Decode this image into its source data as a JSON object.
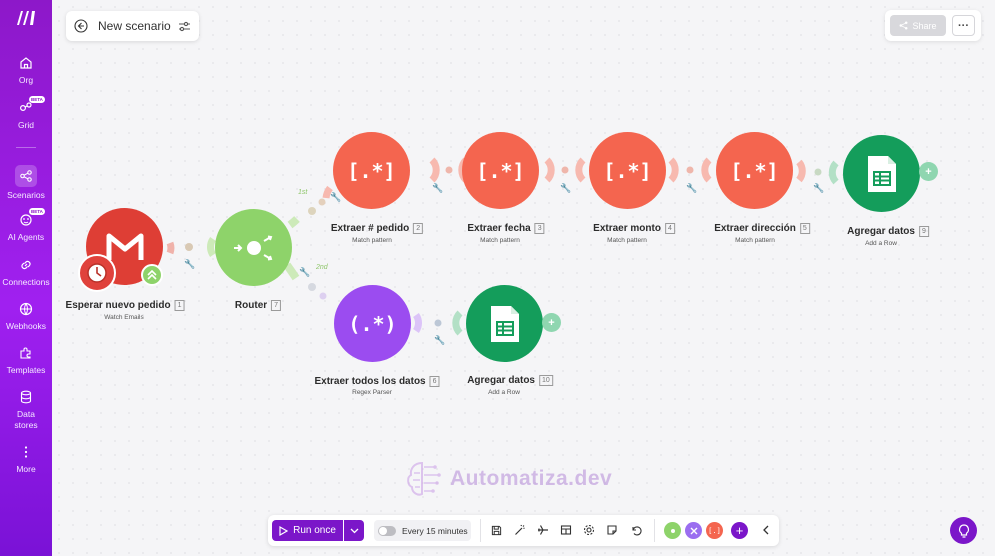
{
  "sidebar": {
    "items": [
      {
        "label": "Org",
        "icon": "home-icon"
      },
      {
        "label": "Grid",
        "icon": "grid-icon",
        "badge": "BETA"
      },
      {
        "label": "Scenarios",
        "icon": "share-nodes-icon",
        "active": true
      },
      {
        "label": "AI Agents",
        "icon": "ai-agent-icon",
        "badge": "BETA"
      },
      {
        "label": "Connections",
        "icon": "link-icon"
      },
      {
        "label": "Webhooks",
        "icon": "globe-icon"
      },
      {
        "label": "Templates",
        "icon": "puzzle-icon"
      },
      {
        "label": "Data stores",
        "icon": "database-icon"
      },
      {
        "label": "More",
        "icon": "more-vertical-icon"
      }
    ]
  },
  "header": {
    "title": "New scenario",
    "share_label": "Share",
    "more_label": "···"
  },
  "modules": {
    "gmail": {
      "name": "Esperar nuevo pedido",
      "num": "1",
      "sub": "Watch Emails",
      "color": "#de3e35"
    },
    "router": {
      "name": "Router",
      "num": "7",
      "color": "#8ed36a"
    },
    "extract_order": {
      "name": "Extraer # pedido",
      "num": "2",
      "sub": "Match pattern",
      "color": "#f4654f"
    },
    "extract_date": {
      "name": "Extraer fecha",
      "num": "3",
      "sub": "Match pattern",
      "color": "#f4654f"
    },
    "extract_amount": {
      "name": "Extraer monto",
      "num": "4",
      "sub": "Match pattern",
      "color": "#f4654f"
    },
    "extract_address": {
      "name": "Extraer dirección",
      "num": "5",
      "sub": "Match pattern",
      "color": "#f4654f"
    },
    "sheets_top": {
      "name": "Agregar datos",
      "num": "9",
      "sub": "Add a Row",
      "color": "#149d5b"
    },
    "regex_all": {
      "name": "Extraer todos los datos",
      "num": "6",
      "sub": "Regex Parser",
      "color": "#9b4cf0"
    },
    "sheets_bottom": {
      "name": "Agregar datos",
      "num": "10",
      "sub": "Add a Row",
      "color": "#149d5b"
    }
  },
  "module_icons": {
    "regex": "[.*]",
    "regex_parser": "(.*)"
  },
  "routes": {
    "first": "1st",
    "second": "2nd"
  },
  "watermark": {
    "text": "Automatiza.dev"
  },
  "toolbar": {
    "run_label": "Run once",
    "schedule_label": "Every 15 minutes"
  }
}
